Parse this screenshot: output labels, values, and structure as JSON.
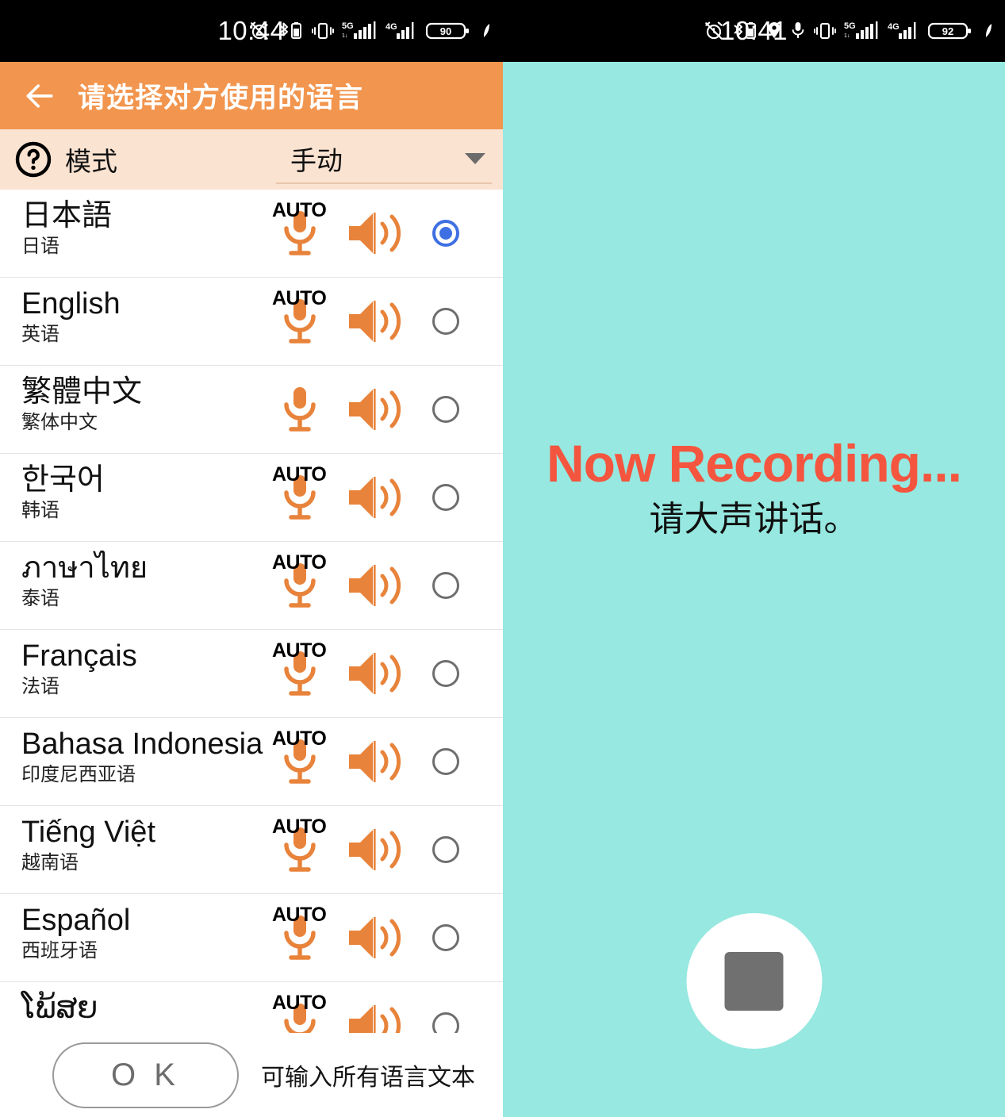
{
  "left": {
    "status_bar": {
      "time": "10:44",
      "battery": "90",
      "icons": [
        "alarm-off-icon",
        "bluetooth-battery-icon",
        "vibrate-icon",
        "5g-signal-icon",
        "4g-signal-icon",
        "battery-icon",
        "leaf-icon"
      ],
      "net_labels": [
        "5G",
        "4G"
      ]
    },
    "appbar": {
      "back_icon": "back-arrow-icon",
      "title": "请选择对方使用的语言",
      "bg_color": "#F2954E"
    },
    "mode_bar": {
      "help_icon": "help-circle-icon",
      "label": "模式",
      "value": "手动",
      "caret_icon": "chevron-down-icon",
      "bg_color": "#FBE3D1"
    },
    "languages": [
      {
        "native": "日本語",
        "chinese": "日语",
        "auto": "AUTO",
        "has_auto": true,
        "selected": true
      },
      {
        "native": "English",
        "chinese": "英语",
        "auto": "AUTO",
        "has_auto": true,
        "selected": false
      },
      {
        "native": "繁體中文",
        "chinese": "繁体中文",
        "auto": "",
        "has_auto": false,
        "selected": false
      },
      {
        "native": "한국어",
        "chinese": "韩语",
        "auto": "AUTO",
        "has_auto": true,
        "selected": false
      },
      {
        "native": "ภาษาไทย",
        "chinese": "泰语",
        "auto": "AUTO",
        "has_auto": true,
        "selected": false
      },
      {
        "native": "Français",
        "chinese": "法语",
        "auto": "AUTO",
        "has_auto": true,
        "selected": false
      },
      {
        "native": "Bahasa Indonesia",
        "chinese": "印度尼西亚语",
        "auto": "AUTO",
        "has_auto": true,
        "selected": false
      },
      {
        "native": "Tiếng Việt",
        "chinese": "越南语",
        "auto": "AUTO",
        "has_auto": true,
        "selected": false
      },
      {
        "native": "Español",
        "chinese": "西班牙语",
        "auto": "AUTO",
        "has_auto": true,
        "selected": false
      },
      {
        "native": "ໂພ້ສຍ",
        "chinese": "",
        "auto": "AUTO",
        "has_auto": true,
        "selected": false
      }
    ],
    "bottom": {
      "ok_label": "O K",
      "hint": "可输入所有语言文本"
    },
    "accent_color": "#E8833B",
    "selected_radio_color": "#3E6FE3"
  },
  "right": {
    "status_bar": {
      "time": "10:41",
      "battery": "92",
      "icons": [
        "alarm-off-icon",
        "bluetooth-battery-icon",
        "location-icon",
        "mic-icon",
        "vibrate-icon",
        "5g-signal-icon",
        "4g-signal-icon",
        "battery-icon",
        "leaf-icon"
      ],
      "net_labels": [
        "5G",
        "4G"
      ]
    },
    "recording": {
      "title": "Now Recording...",
      "subtitle": "请大声讲话。",
      "title_color": "#F4553F",
      "bg_color": "#96E8E0",
      "stop_button_icon": "stop-square-icon"
    }
  }
}
